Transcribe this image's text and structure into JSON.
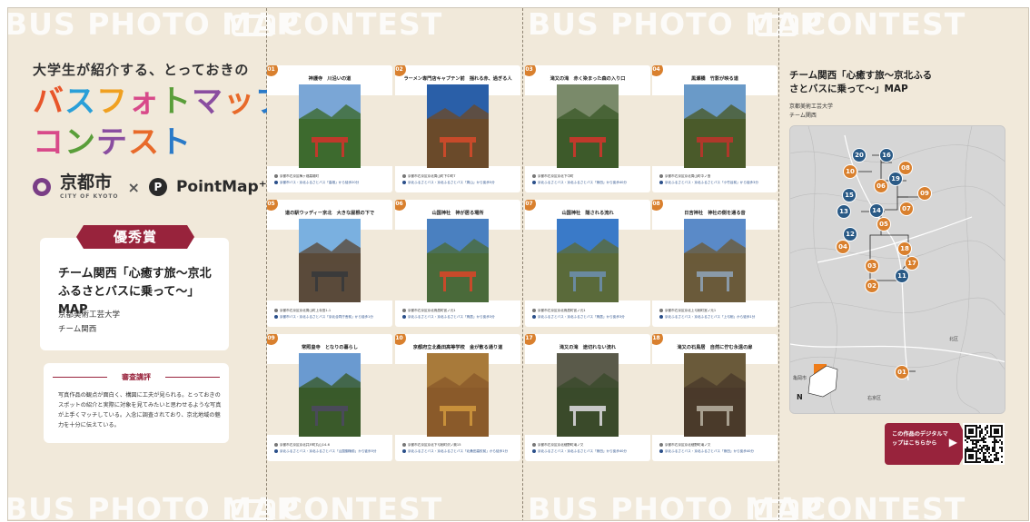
{
  "watermark": {
    "bus": "BUS PHOTO MAP",
    "contest": "CONTEST"
  },
  "left": {
    "tagline": "大学生が紹介する、とっておきの",
    "logo_line1": [
      "バ",
      "ス",
      "フ",
      "ォ",
      "ト",
      "マ",
      "ッ",
      "プ"
    ],
    "logo_line2": [
      "コ",
      "ン",
      "テ",
      "ス",
      "ト"
    ],
    "logo_colors": [
      "#e8562a",
      "#2a9fd8",
      "#f0a020",
      "#d84a8a",
      "#5a9e3a",
      "#8a4ea0",
      "#e86a2a",
      "#2a7ac8"
    ],
    "partner_city": "京都市",
    "partner_city_sub": "CITY OF KYOTO",
    "times": "×",
    "partner_app": "PointMap⁺",
    "partner_app_icon": "P",
    "award": "優秀賞",
    "award_title": "チーム関西「心癒す旅〜京北ふるさとバスに乗って〜」MAP",
    "award_univ": "京都美術工芸大学",
    "award_team": "チーム関西",
    "review_heading": "審査講評",
    "review_text": "写真作品の観点が面白く、構図に工夫が見られる。とっておきのスポットの紹介と実際に対象を見てみたいと思わせるような写真が上手くマッチしている。入念に調査されており、京北地域の魅力を十分に伝えている。"
  },
  "cards": [
    {
      "num": "01",
      "title": "神護寺　川沿いの道",
      "cap1": "京都市右京区梅ヶ畑高雄町",
      "cap2": "京都市バス・京北ふるさとバス「高雄」から徒歩20分",
      "sky": "#7aa6d6",
      "ground": "#3d6a2e",
      "accent": "#c0392b"
    },
    {
      "num": "02",
      "title": "ラーメン専門店キャプテン前　揺れる赤、過ぎる人",
      "cap1": "京都市右京区京北周山町下中町7",
      "cap2": "京北ふるさとバス・京北ふるさとバス「周山」から徒歩5分",
      "sky": "#2a5fa8",
      "ground": "#6a4a2a",
      "accent": "#c84a2a"
    },
    {
      "num": "03",
      "title": "滝又の滝　赤く染まった森の入り口",
      "cap1": "京都市右京区京北下中町",
      "cap2": "京北ふるさとバス・京北ふるさとバス「熊田」から徒歩40分",
      "sky": "#7a8a6a",
      "ground": "#3d5a2a",
      "accent": "#c0392b"
    },
    {
      "num": "04",
      "title": "黒瀬橋　竹影が映る道",
      "cap1": "京都市右京区京北周山町中ノ島",
      "cap2": "京北ふるさとバス・京北ふるさとバス「小竹谷前」から徒歩3分",
      "sky": "#6a9ac8",
      "ground": "#4a5a2a",
      "accent": "#b0382a"
    },
    {
      "num": "05",
      "title": "道の駅ウッディー京北　大きな屋根の下で",
      "cap1": "京都市右京区京北周山町上寺田1-1",
      "cap2": "京都市バス・京北ふるさとバス「京北合同庁舎前」から徒歩1分",
      "sky": "#7ab0e0",
      "ground": "#5a4a3a",
      "accent": "#3a3a3a"
    },
    {
      "num": "06",
      "title": "山国神社　神が居る場所",
      "cap1": "京都市右京区京北鳥居町宮ノ元1",
      "cap2": "京北ふるさとバス・京北ふるさとバス「鳥居」から徒歩3分",
      "sky": "#4a80c0",
      "ground": "#4a6a3a",
      "accent": "#c84a2a"
    },
    {
      "num": "07",
      "title": "山国神社　隠される流れ",
      "cap1": "京都市右京区京北鳥居町宮ノ元1",
      "cap2": "京北ふるさとバス・京北ふるさとバス「鳥居」から徒歩3分",
      "sky": "#3a7ac8",
      "ground": "#5a6a3a",
      "accent": "#6a8aa0"
    },
    {
      "num": "08",
      "title": "日吉神社　神社の側を通る音",
      "cap1": "京都市右京区京北上弓削町宮ノ元1",
      "cap2": "京北ふるさとバス・京北ふるさとバス「上弓削」から徒歩1分",
      "sky": "#5a8ac8",
      "ground": "#6a5a3a",
      "accent": "#8a9aa8"
    },
    {
      "num": "09",
      "title": "常照皇寺　となりの暮らし",
      "cap1": "京都市右京区京北井戸町丸山14-6",
      "cap2": "京北ふるさとバス・京北ふるさとバス「山国御陵前」から徒歩5分",
      "sky": "#6a9ad0",
      "ground": "#3a5a2a",
      "accent": "#4a4a5a"
    },
    {
      "num": "10",
      "title": "京都府立北桑田高等学校　金が散る通り道",
      "cap1": "京都市右京区京北下弓削町沢ノ奥15",
      "cap2": "京北ふるさとバス・京北ふるさとバス「北桑田高校前」から徒歩1分",
      "sky": "#a87a3a",
      "ground": "#8a5a2a",
      "accent": "#c8903a"
    },
    {
      "num": "17",
      "title": "滝又の滝　途切れない流れ",
      "cap1": "京都市右京区京北細野町滝ノ又",
      "cap2": "京北ふるさとバス・京北ふるさとバス「熊田」から徒歩40分",
      "sky": "#5a5a4a",
      "ground": "#3a4a2a",
      "accent": "#c8c8c8"
    },
    {
      "num": "18",
      "title": "滝又の石鳥居　自然に佇む永遠の扉",
      "cap1": "京都市右京区京北細野町滝ノ又",
      "cap2": "京北ふるさとバス・京北ふるさとバス「熊田」から徒歩40分",
      "sky": "#6a5a3a",
      "ground": "#4a3a2a",
      "accent": "#a8a090"
    }
  ],
  "right": {
    "title": "チーム関西「心癒す旅〜京北ふるさとバスに乗って〜」MAP",
    "univ": "京都美術工芸大学",
    "team": "チーム関西",
    "map_labels": [
      "亀岡市",
      "右京区",
      "北区"
    ],
    "compass": "N",
    "markers": [
      {
        "n": "20",
        "c": "b"
      },
      {
        "n": "16",
        "c": "b"
      },
      {
        "n": "10",
        "c": "o"
      },
      {
        "n": "08",
        "c": "o"
      },
      {
        "n": "19",
        "c": "b"
      },
      {
        "n": "06",
        "c": "o"
      },
      {
        "n": "09",
        "c": "o"
      },
      {
        "n": "15",
        "c": "b"
      },
      {
        "n": "07",
        "c": "o"
      },
      {
        "n": "13",
        "c": "b"
      },
      {
        "n": "14",
        "c": "b"
      },
      {
        "n": "05",
        "c": "o"
      },
      {
        "n": "12",
        "c": "b"
      },
      {
        "n": "04",
        "c": "o"
      },
      {
        "n": "18",
        "c": "o"
      },
      {
        "n": "03",
        "c": "o"
      },
      {
        "n": "17",
        "c": "o"
      },
      {
        "n": "11",
        "c": "b"
      },
      {
        "n": "02",
        "c": "o"
      },
      {
        "n": "01",
        "c": "o"
      }
    ],
    "qr_cta": "この作品のデジタルマップはこちらから",
    "qr_arrow": "▶"
  },
  "colors": {
    "brand_red": "#98233c",
    "marker_orange": "#d9802e",
    "marker_blue": "#2a5a86",
    "paper": "#f1e9da"
  }
}
